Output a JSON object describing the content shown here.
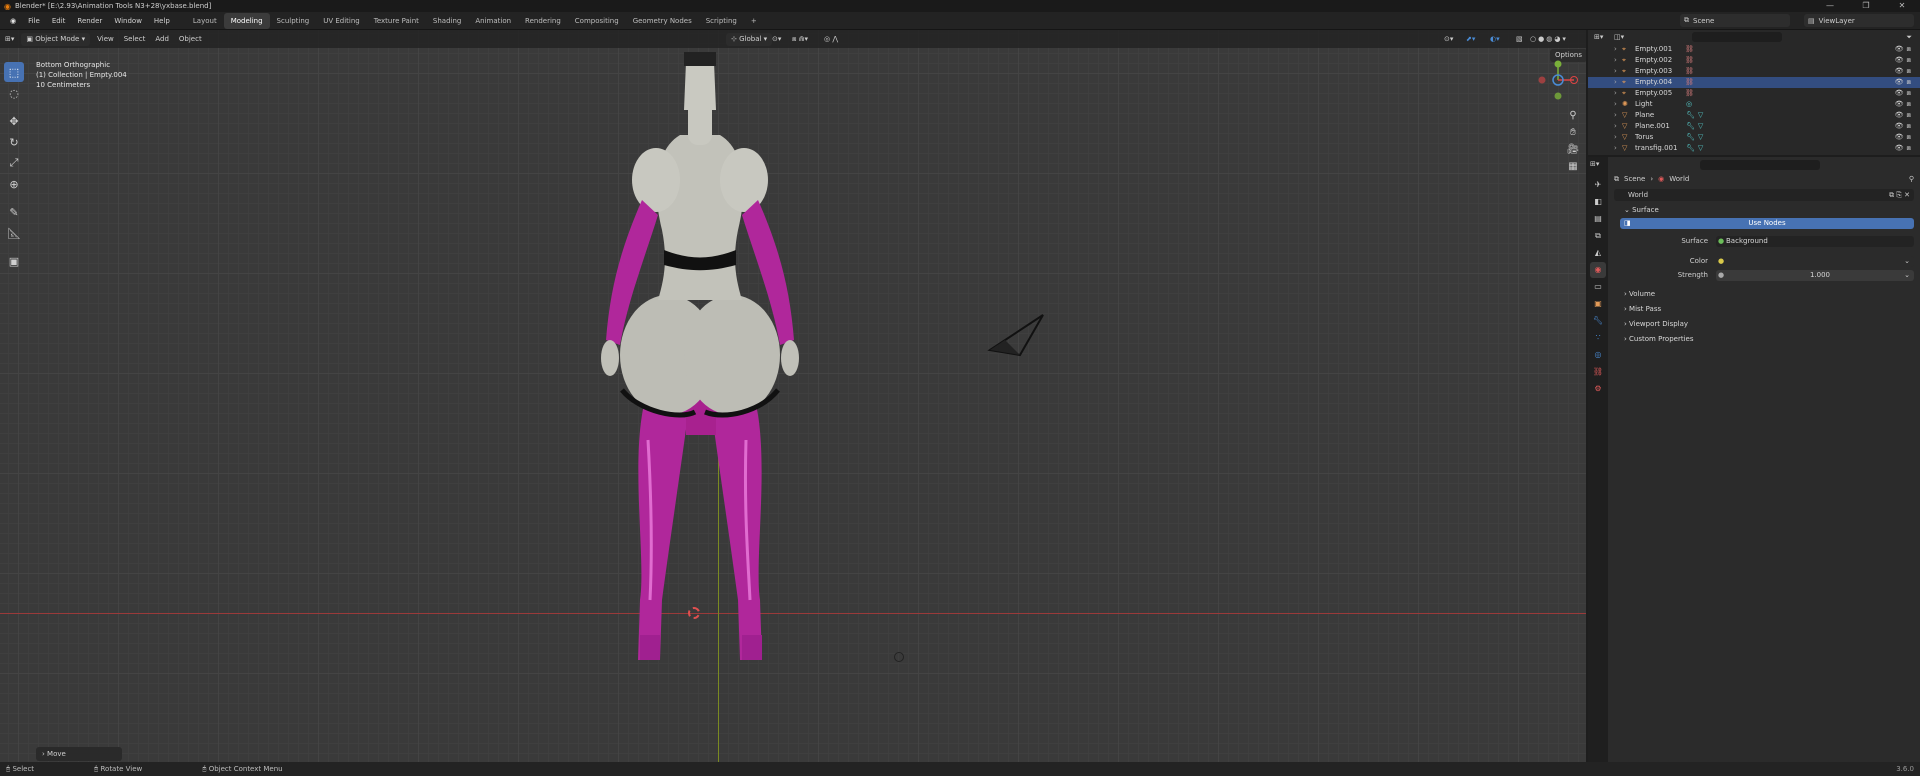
{
  "titlebar": {
    "title": "Blender* [E:\\2.93\\Animation Tools N3+28\\yxbase.blend]"
  },
  "menu": [
    "File",
    "Edit",
    "Render",
    "Window",
    "Help"
  ],
  "workspaces": [
    {
      "label": "Layout",
      "active": false
    },
    {
      "label": "Modeling",
      "active": true
    },
    {
      "label": "Sculpting",
      "active": false
    },
    {
      "label": "UV Editing",
      "active": false
    },
    {
      "label": "Texture Paint",
      "active": false
    },
    {
      "label": "Shading",
      "active": false
    },
    {
      "label": "Animation",
      "active": false
    },
    {
      "label": "Rendering",
      "active": false
    },
    {
      "label": "Compositing",
      "active": false
    },
    {
      "label": "Geometry Nodes",
      "active": false
    },
    {
      "label": "Scripting",
      "active": false
    }
  ],
  "add_workspace": "+",
  "scene": "Scene",
  "view_layer": "ViewLayer",
  "viewport": {
    "mode": "Object Mode",
    "menus": [
      "View",
      "Select",
      "Add",
      "Object"
    ],
    "orientation": "Global",
    "options": "Options",
    "info": [
      "Bottom Orthographic",
      "(1) Collection | Empty.004",
      "10 Centimeters"
    ],
    "last_operator": "Move"
  },
  "outliner": {
    "items": [
      {
        "name": "Empty.001",
        "selected": false,
        "type": "empty"
      },
      {
        "name": "Empty.002",
        "selected": false,
        "type": "empty"
      },
      {
        "name": "Empty.003",
        "selected": false,
        "type": "empty"
      },
      {
        "name": "Empty.004",
        "selected": true,
        "type": "empty"
      },
      {
        "name": "Empty.005",
        "selected": false,
        "type": "empty"
      },
      {
        "name": "Light",
        "selected": false,
        "type": "light"
      },
      {
        "name": "Plane",
        "selected": false,
        "type": "mesh"
      },
      {
        "name": "Plane.001",
        "selected": false,
        "type": "mesh"
      },
      {
        "name": "Torus",
        "selected": false,
        "type": "mesh"
      },
      {
        "name": "transfig.001",
        "selected": false,
        "type": "mesh"
      }
    ]
  },
  "properties": {
    "breadcrumb": [
      "Scene",
      "World"
    ],
    "world_name": "World",
    "surface_panel": "Surface",
    "use_nodes": "Use Nodes",
    "surface_label": "Surface",
    "surface_value": "Background",
    "color_label": "Color",
    "strength_label": "Strength",
    "strength_value": "1.000",
    "panels": [
      "Volume",
      "Mist Pass",
      "Viewport Display",
      "Custom Properties"
    ]
  },
  "statusbar": {
    "items": [
      "Select",
      "Rotate View",
      "Object Context Menu"
    ],
    "version": "3.6.0"
  },
  "colors": {
    "accent": "#4772b3",
    "selected_row": "#334d80",
    "x_axis": "#9a3a3a",
    "y_axis": "#7a8a22",
    "suit": "#b0279b"
  }
}
